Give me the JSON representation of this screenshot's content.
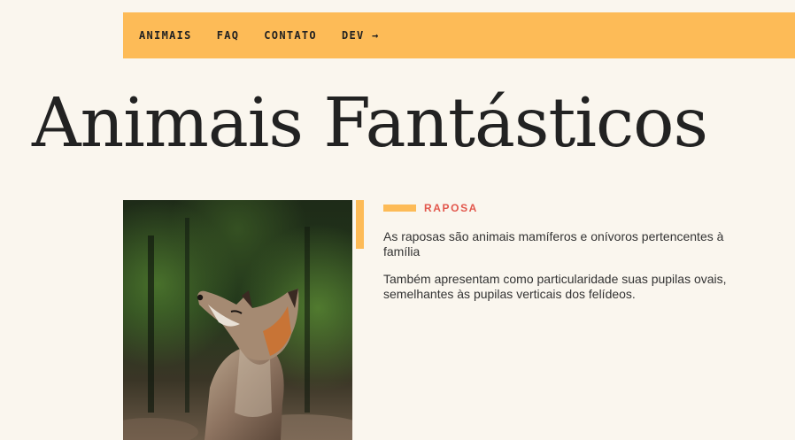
{
  "nav": {
    "items": [
      {
        "label": "ANIMAIS"
      },
      {
        "label": "FAQ"
      },
      {
        "label": "CONTATO"
      },
      {
        "label": "DEV →"
      }
    ]
  },
  "page": {
    "title": "Animais Fantásticos"
  },
  "feature": {
    "image_icon": "fox-photo",
    "category": "RAPOSA",
    "paragraphs": [
      "As raposas são animais mamíferos e onívoros pertencentes à família",
      "Também apresentam como particularidade suas pupilas ovais, semelhantes às pupilas verticais dos felídeos."
    ]
  },
  "colors": {
    "background": "#faf6ee",
    "accent": "#fdbb57",
    "category_label": "#e2574c",
    "text": "#222222"
  }
}
